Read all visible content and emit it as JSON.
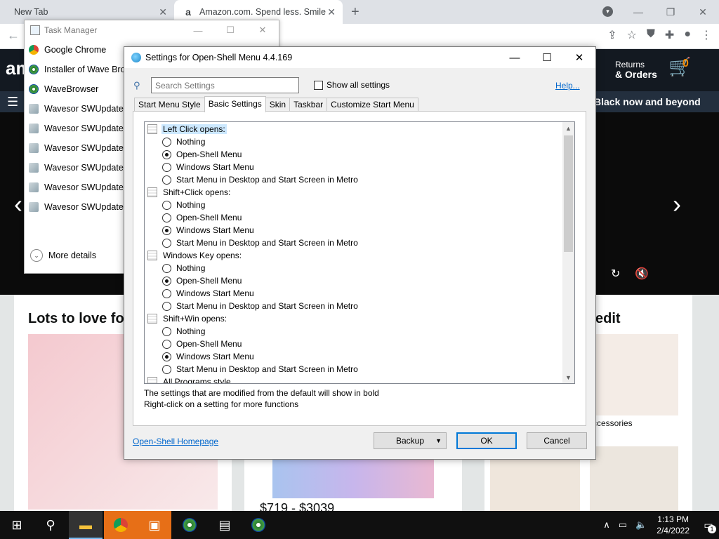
{
  "browser": {
    "tabs": [
      {
        "title": "New Tab"
      },
      {
        "title": "Amazon.com. Spend less. Smile"
      }
    ],
    "favicon_letter": "a",
    "new_tab_symbol": "+",
    "close_symbol": "✕"
  },
  "amazon": {
    "logo": "am",
    "returns_line1": "Returns",
    "returns_line2": "& Orders",
    "cart_count": "0",
    "promo": "Black now and beyond",
    "card1_title": "Lots to love fo",
    "card2_title": "edit",
    "card_caption": "ccessories",
    "price": "$719 - $3039"
  },
  "task_manager": {
    "title": "Task Manager",
    "items": [
      {
        "label": "Google Chrome",
        "icon": "chrome-icon"
      },
      {
        "label": "Installer of Wave Brov",
        "icon": "wave-icon"
      },
      {
        "label": "WaveBrowser",
        "icon": "wave-icon"
      },
      {
        "label": "Wavesor SWUpdater (",
        "icon": "updater-icon"
      },
      {
        "label": "Wavesor SWUpdater (",
        "icon": "updater-icon"
      },
      {
        "label": "Wavesor SWUpdater (",
        "icon": "updater-icon"
      },
      {
        "label": "Wavesor SWUpdater (",
        "icon": "updater-icon"
      },
      {
        "label": "Wavesor SWUpdater (",
        "icon": "updater-icon"
      },
      {
        "label": "Wavesor SWUpdater (",
        "icon": "updater-icon"
      }
    ],
    "more_details": "More details"
  },
  "settings": {
    "title": "Settings for Open-Shell Menu 4.4.169",
    "search_placeholder": "Search Settings",
    "show_all": "Show all settings",
    "help": "Help...",
    "tabs": [
      "Start Menu Style",
      "Basic Settings",
      "Skin",
      "Taskbar",
      "Customize Start Menu"
    ],
    "active_tab": 1,
    "groups": [
      {
        "label": "Left Click opens:",
        "selected": true,
        "options": [
          {
            "label": "Nothing",
            "checked": false
          },
          {
            "label": "Open-Shell Menu",
            "checked": true
          },
          {
            "label": "Windows Start Menu",
            "checked": false
          },
          {
            "label": "Start Menu in Desktop and Start Screen in Metro",
            "checked": false
          }
        ]
      },
      {
        "label": "Shift+Click opens:",
        "selected": false,
        "options": [
          {
            "label": "Nothing",
            "checked": false
          },
          {
            "label": "Open-Shell Menu",
            "checked": false
          },
          {
            "label": "Windows Start Menu",
            "checked": true
          },
          {
            "label": "Start Menu in Desktop and Start Screen in Metro",
            "checked": false
          }
        ]
      },
      {
        "label": "Windows Key opens:",
        "selected": false,
        "options": [
          {
            "label": "Nothing",
            "checked": false
          },
          {
            "label": "Open-Shell Menu",
            "checked": true
          },
          {
            "label": "Windows Start Menu",
            "checked": false
          },
          {
            "label": "Start Menu in Desktop and Start Screen in Metro",
            "checked": false
          }
        ]
      },
      {
        "label": "Shift+Win opens:",
        "selected": false,
        "options": [
          {
            "label": "Nothing",
            "checked": false
          },
          {
            "label": "Open-Shell Menu",
            "checked": false
          },
          {
            "label": "Windows Start Menu",
            "checked": true
          },
          {
            "label": "Start Menu in Desktop and Start Screen in Metro",
            "checked": false
          }
        ]
      },
      {
        "label": "All Programs style",
        "selected": false,
        "options": []
      }
    ],
    "note1": "The settings that are modified from the default will show in bold",
    "note2": "Right-click on a setting for more functions",
    "homepage": "Open-Shell Homepage",
    "backup": "Backup",
    "ok": "OK",
    "cancel": "Cancel"
  },
  "taskbar": {
    "time": "1:13 PM",
    "date": "2/4/2022",
    "notifications": "1"
  },
  "colors": {
    "accent": "#0078d7",
    "link": "#0066cc",
    "amazon_nav": "#131921"
  }
}
